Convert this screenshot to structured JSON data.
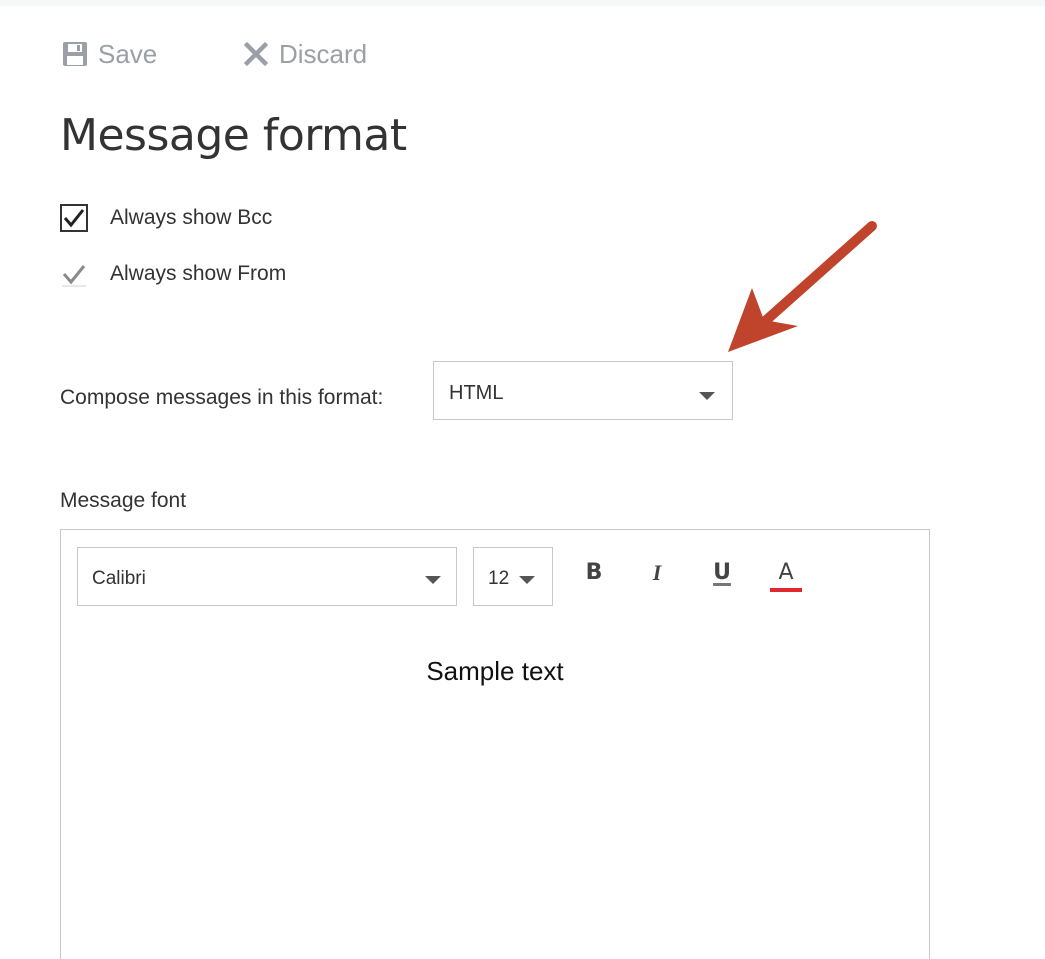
{
  "toolbar": {
    "save_label": "Save",
    "save_icon": "floppy-disk-icon",
    "discard_label": "Discard",
    "discard_icon": "close-x-icon"
  },
  "page": {
    "title": "Message format"
  },
  "options": {
    "always_show_bcc": {
      "label": "Always show Bcc",
      "checked": true
    },
    "always_show_from": {
      "label": "Always show From",
      "checked": true
    }
  },
  "compose": {
    "label": "Compose messages in this format:",
    "selected_format": "HTML"
  },
  "message_font": {
    "heading": "Message font",
    "font_family_value": "Calibri",
    "font_size_value": "12",
    "bold_label": "B",
    "italic_label": "I",
    "underline_label": "U",
    "font_color_label": "A",
    "font_color": "#e0282e",
    "sample_text": "Sample text"
  },
  "annotation": {
    "arrow_color": "#c0432b"
  },
  "colors": {
    "text": "#333333",
    "muted_toolbar": "#9aa0a6",
    "border": "#c8c8c8"
  }
}
